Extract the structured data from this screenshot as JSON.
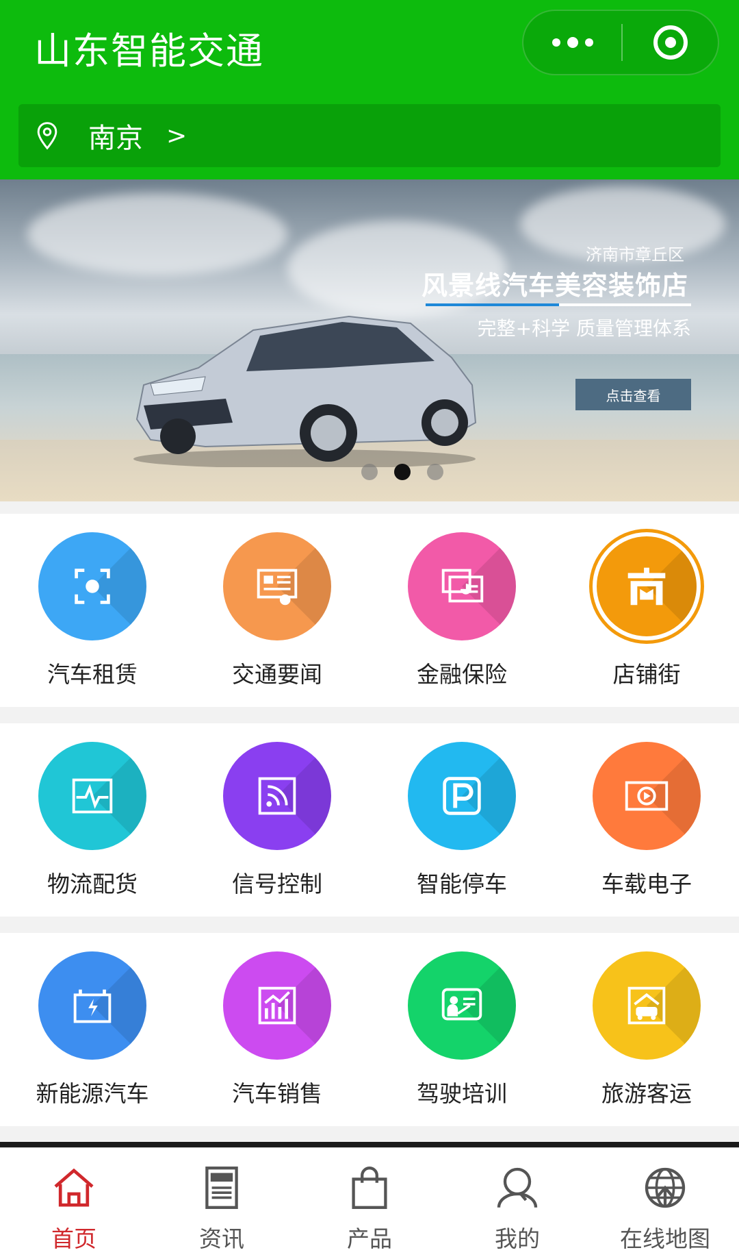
{
  "header": {
    "title": "山东智能交通",
    "location": "南京",
    "location_chevron": ">"
  },
  "banner": {
    "region": "济南市章丘区",
    "shop_name": "风景线汽车美容装饰店",
    "slogan": "完整+科学 质量管理体系",
    "button_label": "点击查看",
    "slides": 3,
    "active_slide": 2
  },
  "categories": [
    [
      {
        "label": "汽车租赁",
        "icon": "camera-scan-icon",
        "color": "#3da7f5"
      },
      {
        "label": "交通要闻",
        "icon": "certificate-icon",
        "color": "#f6984e"
      },
      {
        "label": "金融保险",
        "icon": "presentation-chart-icon",
        "color": "#f25aa8"
      },
      {
        "label": "店铺街",
        "icon": "shop-badge-icon",
        "color": "#f39a0b"
      }
    ],
    [
      {
        "label": "物流配货",
        "icon": "heartbeat-monitor-icon",
        "color": "#20c6d6"
      },
      {
        "label": "信号控制",
        "icon": "signal-feed-icon",
        "color": "#8a3ff0"
      },
      {
        "label": "智能停车",
        "icon": "parking-icon",
        "color": "#22b9f0"
      },
      {
        "label": "车载电子",
        "icon": "video-player-icon",
        "color": "#ff7a3c"
      }
    ],
    [
      {
        "label": "新能源汽车",
        "icon": "battery-charge-icon",
        "color": "#3d8ef0"
      },
      {
        "label": "汽车销售",
        "icon": "sales-chart-icon",
        "color": "#cc4bf0"
      },
      {
        "label": "驾驶培训",
        "icon": "training-board-icon",
        "color": "#14d36a"
      },
      {
        "label": "旅游客运",
        "icon": "travel-car-icon",
        "color": "#f7c21a"
      }
    ]
  ],
  "tabs": [
    {
      "label": "首页",
      "icon": "home-icon",
      "active": true
    },
    {
      "label": "资讯",
      "icon": "news-icon",
      "active": false
    },
    {
      "label": "产品",
      "icon": "shopping-bag-icon",
      "active": false
    },
    {
      "label": "我的",
      "icon": "user-icon",
      "active": false
    },
    {
      "label": "在线地图",
      "icon": "globe-map-icon",
      "active": false
    }
  ],
  "colors": {
    "header_green": "#0dbb0d",
    "location_bar": "#09a109",
    "tab_active": "#d0282c"
  }
}
